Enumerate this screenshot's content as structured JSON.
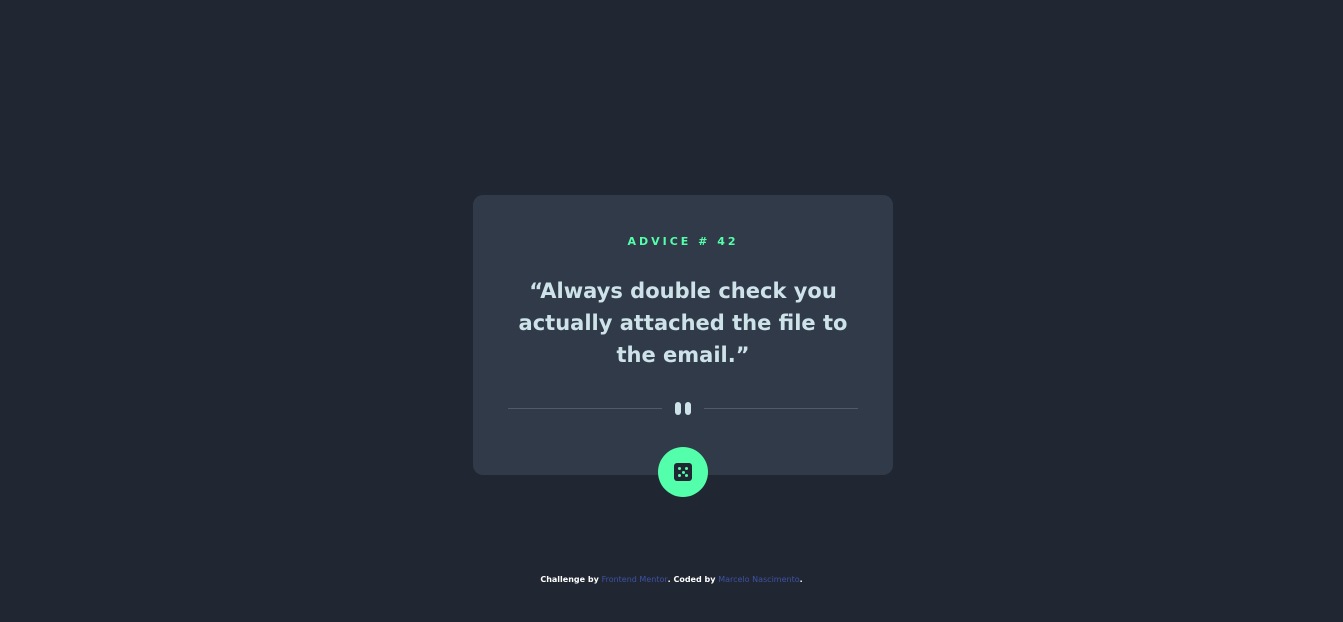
{
  "card": {
    "advice_label": "ADVICE # 42",
    "quote": "“Always double check you actually attached the file to the email.”"
  },
  "divider": {
    "icon": "pause-icon"
  },
  "button": {
    "icon": "dice-icon"
  },
  "footer": {
    "prefix": "Challenge by ",
    "link1": "Frontend Mentor",
    "middle": ". Coded by ",
    "link2": "Marcelo Nascimento",
    "suffix": "."
  },
  "colors": {
    "background": "#202632",
    "card": "#313a49",
    "accent": "#53ffaa",
    "text": "#cee3e9",
    "divider": "#4f5b6d",
    "link": "#3e52a3"
  }
}
